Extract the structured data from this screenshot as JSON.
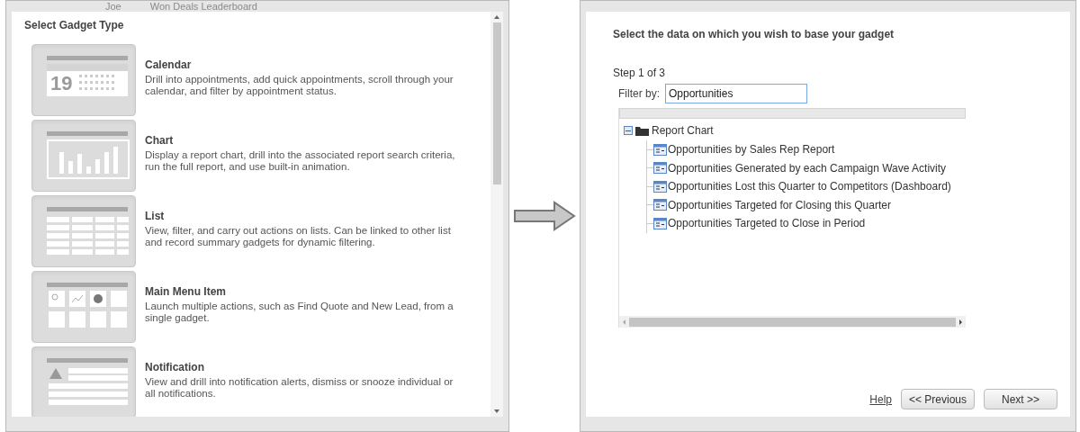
{
  "background_header": {
    "user": "Joe",
    "title": "Won Deals Leaderboard"
  },
  "gadget_type_dialog": {
    "heading": "Select Gadget Type",
    "items": [
      {
        "kind": "calendar",
        "title": "Calendar",
        "description": "Drill into appointments, add quick appointments, scroll through your calendar, and filter by appointment status.",
        "day": "19"
      },
      {
        "kind": "chart",
        "title": "Chart",
        "description": "Display a report chart, drill into the associated report search criteria, run the full report, and use built-in animation."
      },
      {
        "kind": "list",
        "title": "List",
        "description": "View, filter, and carry out actions on lists. Can be linked to other list and record summary gadgets for dynamic filtering."
      },
      {
        "kind": "menu",
        "title": "Main Menu Item",
        "description": "Launch multiple actions, such as Find Quote and New Lead, from a single gadget."
      },
      {
        "kind": "notification",
        "title": "Notification",
        "description": "View and drill into notification alerts, dismiss or snooze individual or all notifications."
      }
    ]
  },
  "data_dialog": {
    "heading": "Select the data on which you wish to base your gadget",
    "step": "Step 1 of 3",
    "filter": {
      "label": "Filter by:",
      "value": "Opportunities"
    },
    "tree": [
      {
        "label": "Report Chart",
        "expanded": true,
        "children": [
          {
            "label": "Opportunities by Sales Rep Report"
          },
          {
            "label": "Opportunities Generated by each Campaign Wave Activity"
          },
          {
            "label": "Opportunities Lost this Quarter to Competitors (Dashboard)"
          },
          {
            "label": "Opportunities Targeted for Closing this Quarter"
          },
          {
            "label": "Opportunities Targeted to Close in Period"
          }
        ]
      }
    ],
    "help": "Help",
    "buttons": [
      "<< Previous",
      "Next >>"
    ]
  }
}
